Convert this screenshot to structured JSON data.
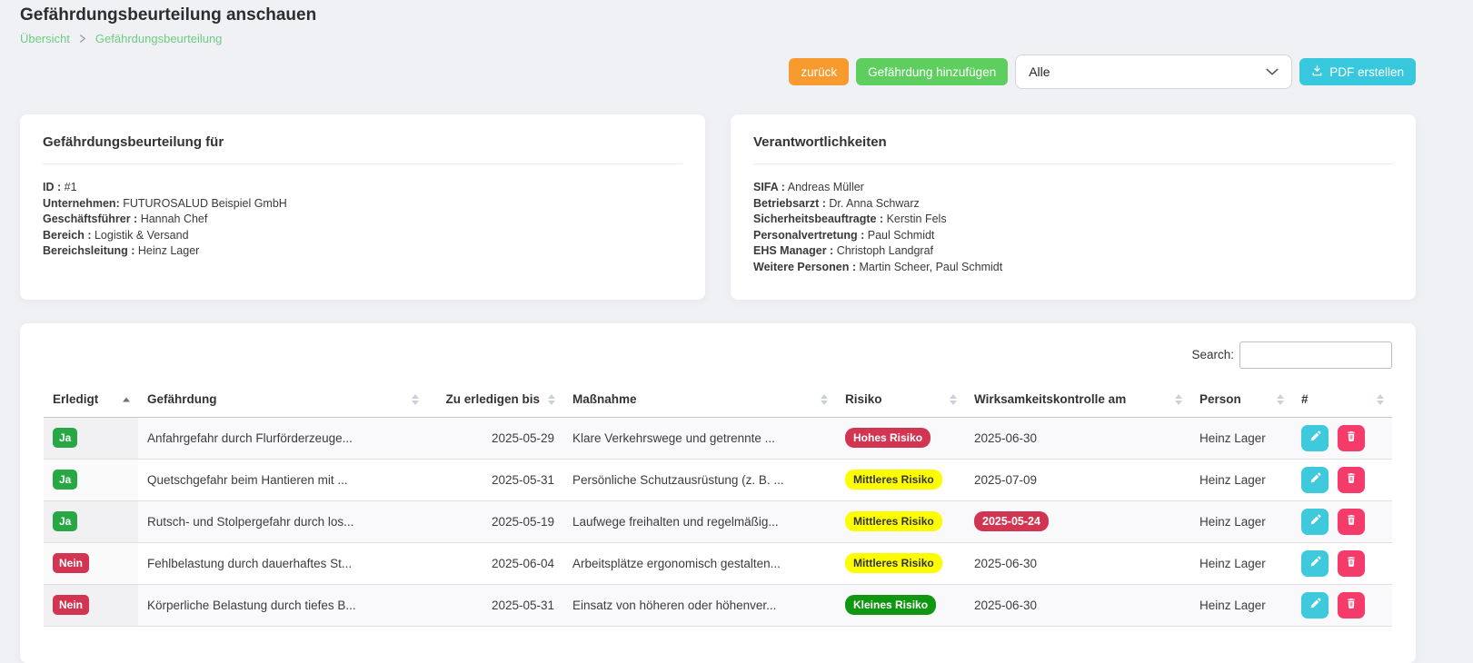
{
  "page": {
    "title": "Gefährdungsbeurteilung anschauen",
    "breadcrumb": {
      "home": "Übersicht",
      "current": "Gefährdungsbeurteilung"
    }
  },
  "toolbar": {
    "back_label": "zurück",
    "add_label": "Gefährdung hinzufügen",
    "filter": {
      "value": "Alle"
    },
    "pdf_label": "PDF erstellen"
  },
  "cards": {
    "assessment": {
      "title": "Gefährdungsbeurteilung für",
      "fields": [
        {
          "label": "ID :",
          "value": "#1"
        },
        {
          "label": "Unternehmen:",
          "value": "FUTUROSALUD Beispiel GmbH"
        },
        {
          "label": "Geschäftsführer :",
          "value": "Hannah Chef"
        },
        {
          "label": "Bereich :",
          "value": "Logistik & Versand"
        },
        {
          "label": "Bereichsleitung :",
          "value": "Heinz Lager"
        }
      ]
    },
    "responsibilities": {
      "title": "Verantwortlichkeiten",
      "fields": [
        {
          "label": "SIFA :",
          "value": "Andreas Müller"
        },
        {
          "label": "Betriebsarzt :",
          "value": "Dr. Anna Schwarz"
        },
        {
          "label": "Sicherheitsbeauftragte :",
          "value": "Kerstin Fels"
        },
        {
          "label": "Personalvertretung :",
          "value": "Paul Schmidt"
        },
        {
          "label": "EHS Manager :",
          "value": "Christoph Landgraf"
        },
        {
          "label": "Weitere Personen :",
          "value": "Martin Scheer, Paul Schmidt"
        }
      ]
    }
  },
  "table": {
    "search_label": "Search:",
    "search_value": "",
    "columns": [
      "Erledigt",
      "Gefährdung",
      "Zu erledigen bis",
      "Maßnahme",
      "Risiko",
      "Wirksamkeitskontrolle am",
      "Person",
      "#"
    ],
    "sort": {
      "column": "Erledigt",
      "direction": "asc"
    },
    "rows": [
      {
        "done": "Ja",
        "hazard": "Anfahrgefahr durch Flurförderzeuge...",
        "due": "2025-05-29",
        "measure": "Klare Verkehrswege und getrennte ...",
        "risk_label": "Hohes Risiko",
        "risk_level": "high",
        "control": "2025-06-30",
        "control_overdue": false,
        "person": "Heinz Lager"
      },
      {
        "done": "Ja",
        "hazard": "Quetschgefahr beim Hantieren mit ...",
        "due": "2025-05-31",
        "measure": "Persönliche Schutzausrüstung (z. B. ...",
        "risk_label": "Mittleres Risiko",
        "risk_level": "medium",
        "control": "2025-07-09",
        "control_overdue": false,
        "person": "Heinz Lager"
      },
      {
        "done": "Ja",
        "hazard": "Rutsch- und Stolpergefahr durch los...",
        "due": "2025-05-19",
        "measure": "Laufwege freihalten und regelmäßig...",
        "risk_label": "Mittleres Risiko",
        "risk_level": "medium",
        "control": "2025-05-24",
        "control_overdue": true,
        "person": "Heinz Lager"
      },
      {
        "done": "Nein",
        "hazard": "Fehlbelastung durch dauerhaftes St...",
        "due": "2025-06-04",
        "measure": "Arbeitsplätze ergonomisch gestalten...",
        "risk_label": "Mittleres Risiko",
        "risk_level": "medium",
        "control": "2025-06-30",
        "control_overdue": false,
        "person": "Heinz Lager"
      },
      {
        "done": "Nein",
        "hazard": "Körperliche Belastung durch tiefes B...",
        "due": "2025-05-31",
        "measure": "Einsatz von höheren oder höhenver...",
        "risk_label": "Kleines Risiko",
        "risk_level": "low",
        "control": "2025-06-30",
        "control_overdue": false,
        "person": "Heinz Lager"
      }
    ]
  },
  "colors": {
    "page_bg": "#f0f1f5",
    "breadcrumb_green": "#6ecb84",
    "accent_orange": "#f89b2f",
    "accent_green": "#5ecf5e",
    "accent_cyan": "#38c8de",
    "badge_done_green": "#28a745",
    "badge_red": "#d23551",
    "badge_yellow": "#fdfd00",
    "badge_small_green": "#119611",
    "action_edit": "#3ec9dc",
    "action_delete": "#f43b69"
  }
}
